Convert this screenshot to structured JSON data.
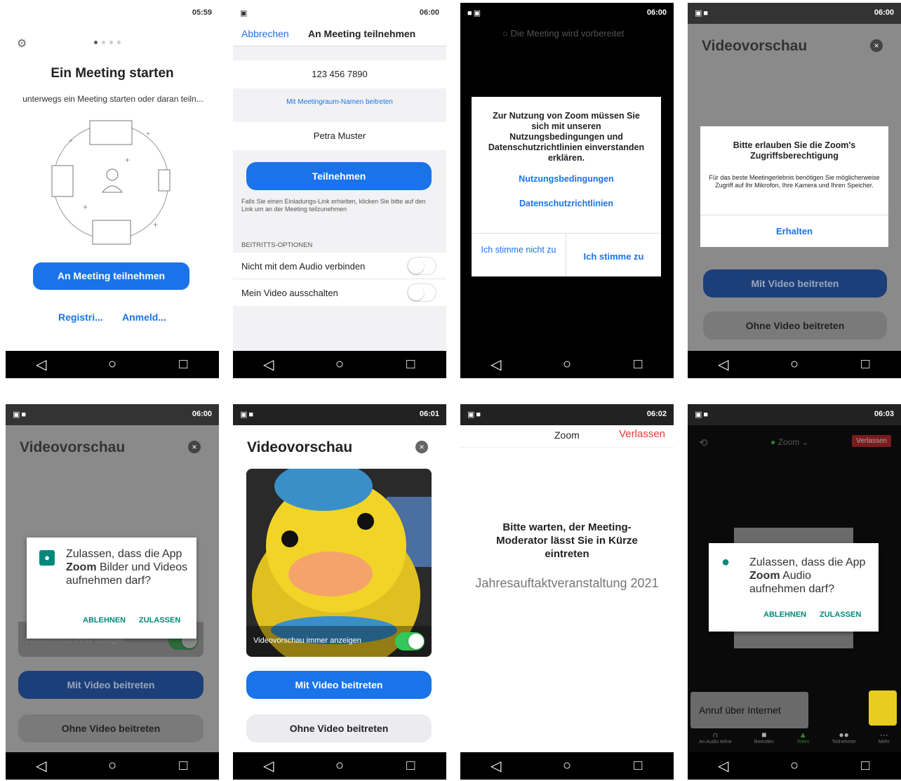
{
  "nav": {
    "back": "◁",
    "home": "○",
    "recent": "□"
  },
  "s1": {
    "status_time": "05:59",
    "title": "Ein Meeting starten",
    "subtitle": "unterwegs ein Meeting starten oder daran teiln...",
    "join_button": "An Meeting teilnehmen",
    "register_link": "Registri...",
    "login_link": "Anmeld..."
  },
  "s2": {
    "status_time": "06:00",
    "cancel": "Abbrechen",
    "title": "An Meeting teilnehmen",
    "meeting_id": "123 456 7890",
    "room_name_link": "Mit Meetingraum-Namen beitreten",
    "name_value": "Petra Muster",
    "join_button": "Teilnehmen",
    "hint": "Falls Sie einen Einladungs-Link erhielten, klicken Sie bitte auf den Link um an der Meeting teilzunehmen",
    "options_header": "BEITRITTS-OPTIONEN",
    "option_audio": "Nicht mit dem Audio verbinden",
    "option_video": "Mein Video ausschalten"
  },
  "s3": {
    "status_time": "06:00",
    "preparing": "Die Meeting wird vorbereitet",
    "dialog_text": "Zur Nutzung von Zoom müssen Sie sich mit unseren Nutzungsbedingungen und Datenschutzrichtlinien einverstanden erklären.",
    "terms_link": "Nutzungsbedingungen",
    "privacy_link": "Datenschutzrichtlinien",
    "decline": "Ich stimme nicht zu",
    "accept": "Ich stimme zu"
  },
  "s4": {
    "status_time": "06:00",
    "title": "Videovorschau",
    "dialog_title": "Bitte erlauben Sie die Zoom's Zugriffsberechtigung",
    "dialog_text": "Für das beste Meetingerlebnis benötigen Sie möglicherweise Zugriff auf Ihr Mikrofon, Ihre Kamera und Ihren Speicher.",
    "get_button": "Erhalten",
    "video_button": "Mit Video beitreten",
    "novideo_button": "Ohne Video beitreten"
  },
  "s5": {
    "status_time": "06:00",
    "title": "Videovorschau",
    "perm_text_a": "Zulassen, dass die App ",
    "perm_app": "Zoom",
    "perm_text_b": " Bilder und Videos aufnehmen darf?",
    "deny": "ABLEHNEN",
    "allow": "ZULASSEN",
    "preview_toggle": "Videovorschau immer anzeigen",
    "video_button": "Mit Video beitreten",
    "novideo_button": "Ohne Video beitreten"
  },
  "s6": {
    "status_time": "06:01",
    "title": "Videovorschau",
    "preview_toggle": "Videovorschau immer anzeigen",
    "video_button": "Mit Video beitreten",
    "novideo_button": "Ohne Video beitreten"
  },
  "s7": {
    "status_time": "06:02",
    "app_title": "Zoom",
    "leave": "Verlassen",
    "wait_text": "Bitte warten, der Meeting-Moderator lässt Sie in Kürze eintreten",
    "meeting_name": "Jahresauftaktveranstaltung 2021"
  },
  "s8": {
    "status_time": "06:03",
    "app_title": "Zoom",
    "leave": "Verlassen",
    "perm_text_a": "Zulassen, dass die App ",
    "perm_app": "Zoom",
    "perm_text_b": " Audio aufnehmen darf?",
    "deny": "ABLEHNEN",
    "allow": "ZULASSEN",
    "tooltip": "Anruf über Internet",
    "toolbar": [
      "An Audio teilne",
      "Beenden",
      "Teilen",
      "Teilnehmer",
      "Mehr"
    ]
  },
  "colors": {
    "accent": "#1a73e8",
    "leave_red": "#e53935",
    "android_teal": "#00897b",
    "toggle_green": "#34c759"
  }
}
